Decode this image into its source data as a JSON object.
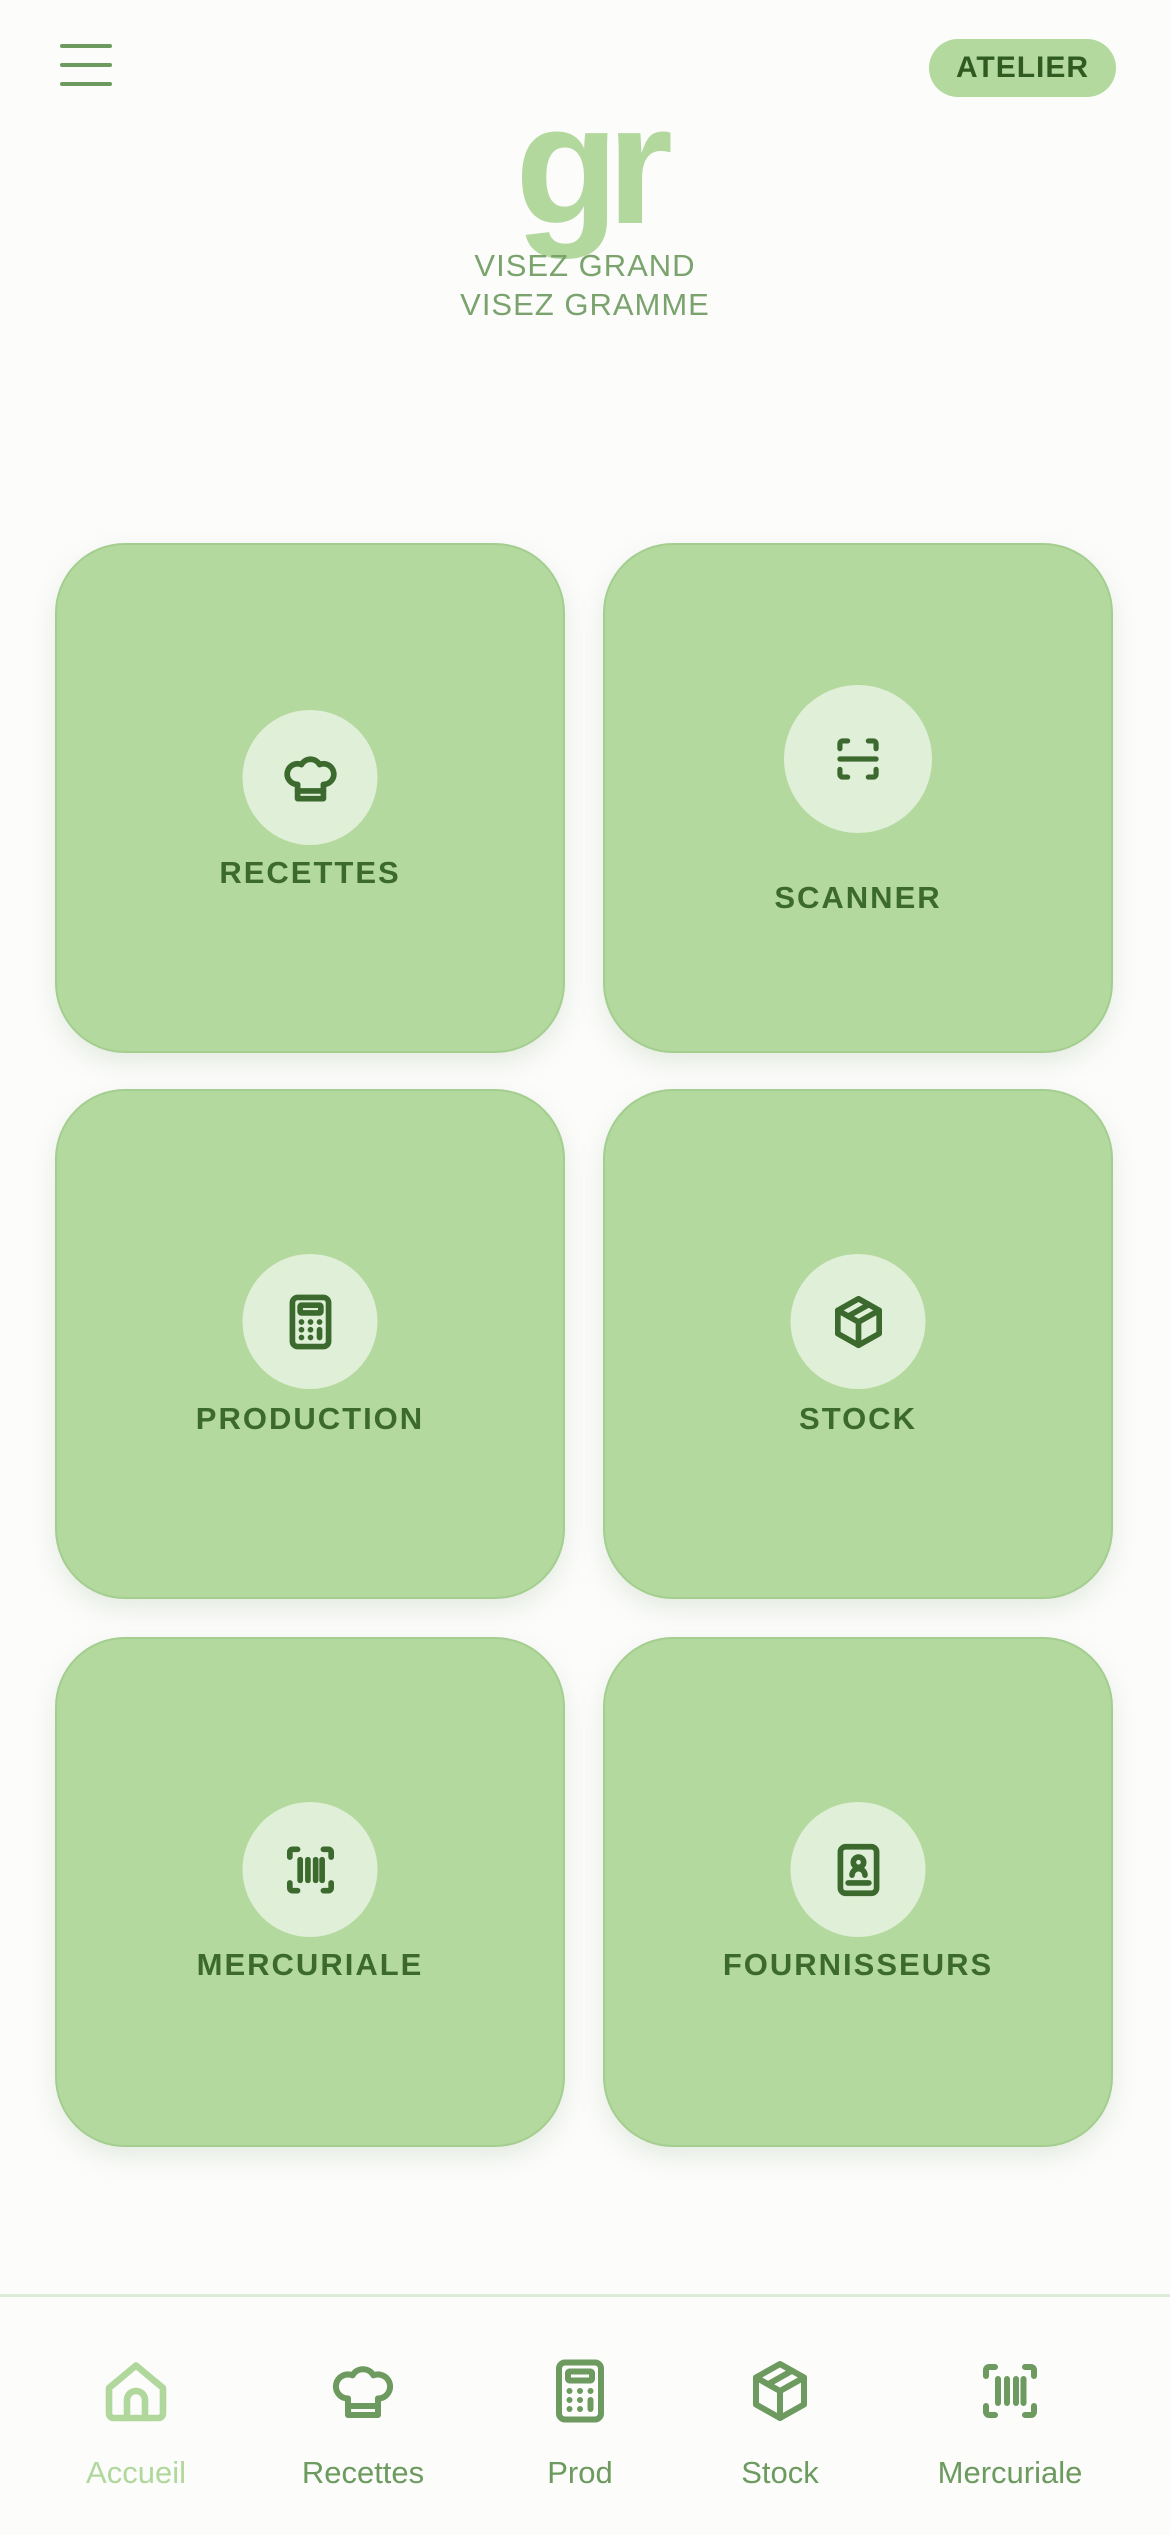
{
  "header": {
    "menu_icon": "hamburger-menu-icon",
    "badge_label": "ATELIER",
    "logo_text": "gr",
    "tagline_line1": "VISEZ GRAND",
    "tagline_line2": "VISEZ GRAMME"
  },
  "tiles": [
    {
      "label": "RECETTES",
      "icon": "chef-hat-icon"
    },
    {
      "label": "SCANNER",
      "icon": "scan-icon"
    },
    {
      "label": "PRODUCTION",
      "icon": "calculator-icon"
    },
    {
      "label": "STOCK",
      "icon": "package-icon"
    },
    {
      "label": "MERCURIALE",
      "icon": "barcode-scan-icon"
    },
    {
      "label": "FOURNISSEURS",
      "icon": "contact-book-icon"
    }
  ],
  "bottom_nav": [
    {
      "label": "Accueil",
      "icon": "home-icon",
      "active": true
    },
    {
      "label": "Recettes",
      "icon": "chef-hat-icon",
      "active": false
    },
    {
      "label": "Prod",
      "icon": "calculator-icon",
      "active": false
    },
    {
      "label": "Stock",
      "icon": "package-icon",
      "active": false
    },
    {
      "label": "Mercuriale",
      "icon": "barcode-scan-icon",
      "active": false
    }
  ],
  "colors": {
    "brand_green": "#b3d99e",
    "dark_green": "#3c6a2e",
    "mid_green": "#6c9a5f",
    "circle_bg": "#e0efd8",
    "background": "#fcfcfb"
  }
}
